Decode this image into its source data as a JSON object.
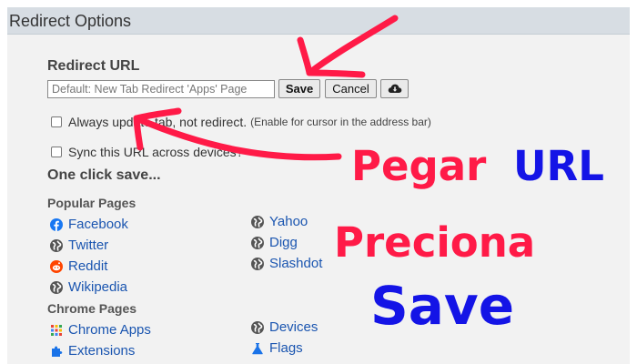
{
  "header": {
    "title": "Redirect Options"
  },
  "redirect": {
    "label": "Redirect URL",
    "placeholder": "Default: New Tab Redirect 'Apps' Page",
    "save_label": "Save",
    "cancel_label": "Cancel"
  },
  "options": {
    "always_update_label": "Always update tab, not redirect.",
    "always_update_note": "(Enable for cursor in the address bar)",
    "sync_label": "Sync this URL across devices?"
  },
  "one_click": {
    "title": "One click save...",
    "popular_title": "Popular Pages",
    "popular_left": [
      "Facebook",
      "Twitter",
      "Reddit",
      "Wikipedia"
    ],
    "popular_right": [
      "Yahoo",
      "Digg",
      "Slashdot"
    ],
    "chrome_title": "Chrome Pages",
    "chrome_left": [
      "Chrome Apps",
      "Extensions"
    ],
    "chrome_right": [
      "Devices",
      "Flags"
    ]
  },
  "annotations": {
    "pegar": "Pegar",
    "url": "URL",
    "preciona": "Preciona",
    "save": "Save"
  },
  "colors": {
    "annotation_red": "#ff1a47",
    "annotation_blue": "#1414e6",
    "link_blue": "#1a55b0",
    "header_bg": "#d7dde3"
  }
}
